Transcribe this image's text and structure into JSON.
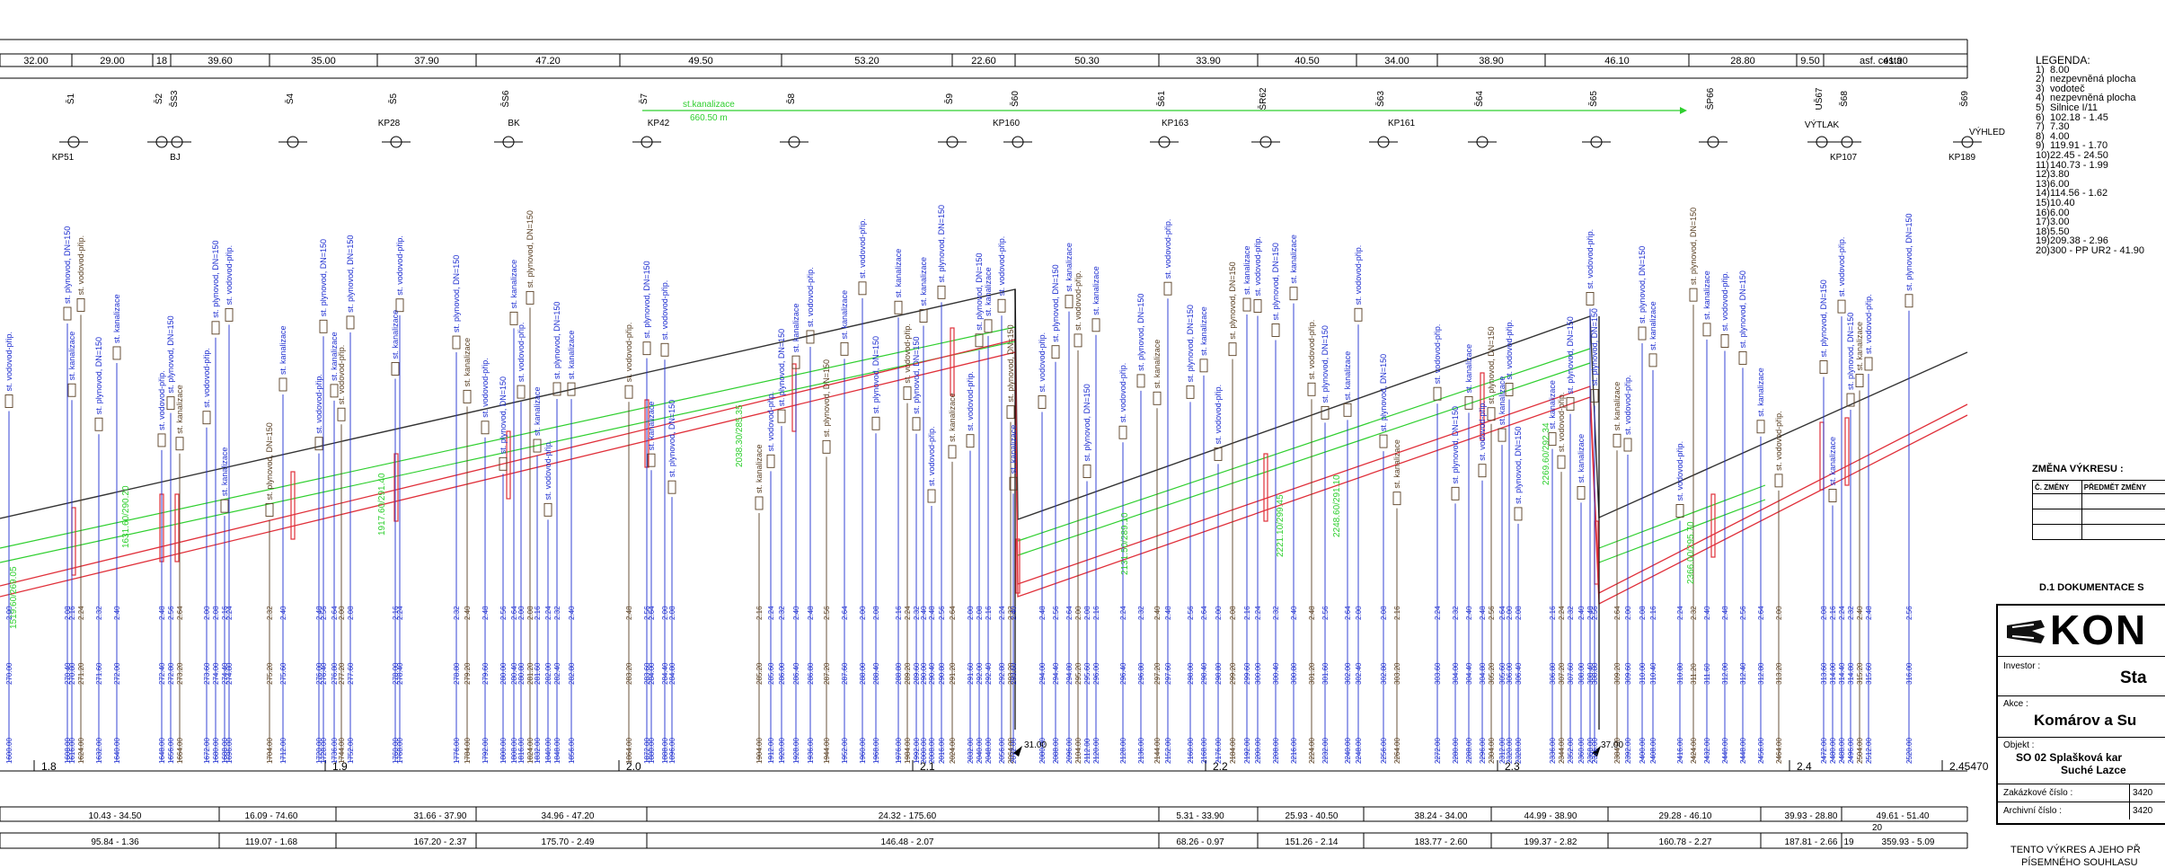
{
  "top_band": {
    "label_right": "asf. cesta",
    "segments": [
      "32.00",
      "29.00",
      "18",
      "39.60",
      "35.00",
      "37.90",
      "47.20",
      "49.50",
      "53.20",
      "22.60",
      "50.30",
      "33.90",
      "40.50",
      "34.00",
      "38.90",
      "46.10",
      "28.80",
      "9.50",
      "41.90"
    ]
  },
  "shafts": [
    "Š1",
    "Š2",
    "ŠS3",
    "Š4",
    "Š5",
    "ŠS6",
    "Š7",
    "Š8",
    "Š9",
    "Š60",
    "Š61",
    "ŠR62",
    "Š63",
    "Š64",
    "Š65",
    "ŠP66",
    "UŠ67",
    "Š68",
    "Š69"
  ],
  "shaft_tags": [
    "KP51",
    "BJ",
    "KP28",
    "BK",
    "KP42",
    "KP160",
    "KP163",
    "KP161",
    "VÝTLAK",
    "KP107",
    "KP189",
    "VÝHLED"
  ],
  "green_line": {
    "label_top": "st.kanalizace",
    "label_bottom": "660.50 m"
  },
  "slopes": [
    "1917.60/291.40",
    "1631.60/290.20",
    "2038.30/285.35",
    "2131.50/289.10",
    "2221.10/299.45",
    "2248.60/291.10",
    "2269.60/292.34",
    "2366.00/295.70",
    "1519.60/269.05"
  ],
  "chainage": [
    "1.8",
    "1.9",
    "2.0",
    "2.1",
    "2.2",
    "2.3",
    "2.4",
    "2.45470"
  ],
  "stationing_label_a": "31.00",
  "stationing_label_b": "37.00",
  "band_row1": [
    "10.43 - 34.50",
    "16.09 - 74.60",
    "31.66 - 37.90",
    "34.96 - 47.20",
    "24.32 - 175.60",
    "5.31 - 33.90",
    "25.93 - 40.50",
    "38.24 - 34.00",
    "44.99 - 38.90",
    "29.28 - 46.10",
    "39.93 - 28.80",
    "49.61 - 51.40"
  ],
  "band_row1_extra": "20",
  "band_row2": [
    "95.84 - 1.36",
    "119.07 - 1.68",
    "167.20 - 2.37",
    "175.70 - 2.49",
    "146.48 - 2.07",
    "68.26 - 0.97",
    "151.26 - 2.14",
    "183.77 - 2.60",
    "199.37 - 2.82",
    "160.78 - 2.27",
    "187.81 - 2.66",
    "19",
    "359.93 - 5.09"
  ],
  "legend": {
    "title": "LEGENDA:",
    "items": [
      {
        "n": "1)",
        "t": "8.00"
      },
      {
        "n": "2)",
        "t": "nezpevněná plocha"
      },
      {
        "n": "3)",
        "t": "vodoteč"
      },
      {
        "n": "4)",
        "t": "nezpevněná plocha"
      },
      {
        "n": "5)",
        "t": "Silnice I/11"
      },
      {
        "n": "6)",
        "t": "102.18 - 1.45"
      },
      {
        "n": "7)",
        "t": "7.30"
      },
      {
        "n": "8)",
        "t": "4.00"
      },
      {
        "n": "9)",
        "t": "119.91 - 1.70"
      },
      {
        "n": "10)",
        "t": "22.45 - 24.50"
      },
      {
        "n": "11)",
        "t": "140.73 - 1.99"
      },
      {
        "n": "12)",
        "t": "3.80"
      },
      {
        "n": "13)",
        "t": "6.00"
      },
      {
        "n": "14)",
        "t": "114.56 - 1.62"
      },
      {
        "n": "15)",
        "t": "10.40"
      },
      {
        "n": "16)",
        "t": "6.00"
      },
      {
        "n": "17)",
        "t": "3.00"
      },
      {
        "n": "18)",
        "t": "5.50"
      },
      {
        "n": "19)",
        "t": "209.38 - 2.96"
      },
      {
        "n": "20)",
        "t": "300 - PP UR2 - 41.90"
      }
    ]
  },
  "change_table": {
    "title": "ZMĚNA VÝKRESU :",
    "col1": "Č. ZMĚNY",
    "col2": "PŘEDMĚT ZMĚNY"
  },
  "title_block": {
    "section": "D.1  DOKUMENTACE S",
    "logo": "KON",
    "investor_label": "Investor :",
    "investor_value": "Sta",
    "akce_label": "Akce :",
    "akce_value": "Komárov a Su",
    "objekt_label": "Objekt :",
    "objekt_line1": "SO 02 Splašková kar",
    "objekt_line2": "Suché Lazce",
    "zakazkove_label": "Zakázkové číslo :",
    "zakazkove_value": "3420",
    "archivni_label": "Archivní číslo :",
    "archivni_value": "3420",
    "foot1": "TENTO VÝKRES A JEHO PŘ",
    "foot2": "PÍSEMNÉHO SOUHLASU"
  },
  "colors": {
    "terrain": "#333333",
    "pipe": "#e0303a",
    "green": "#2fcf2f",
    "blue": "#1f2fd0",
    "brown": "#5a4024"
  }
}
